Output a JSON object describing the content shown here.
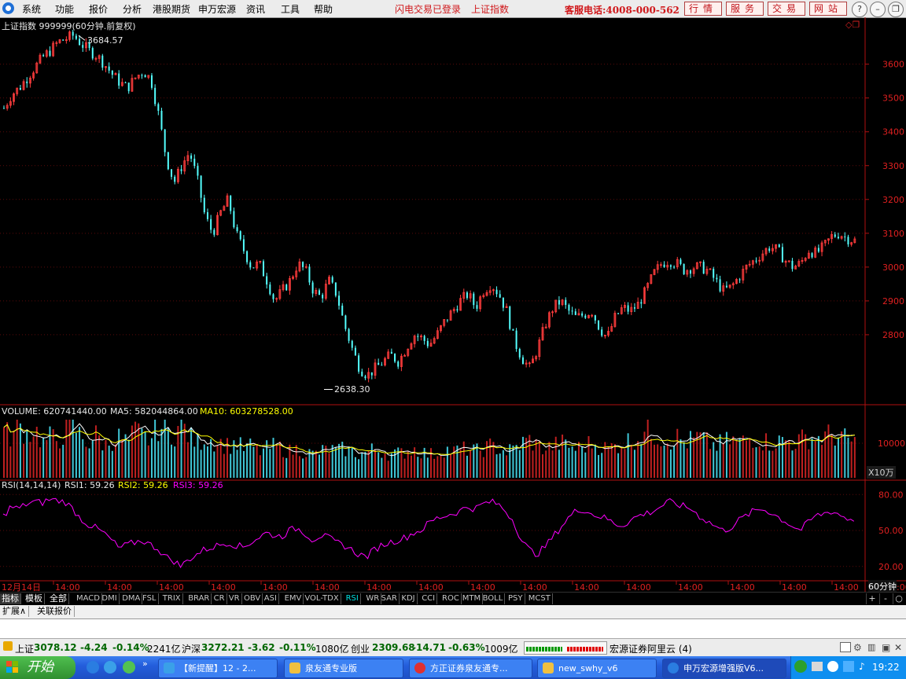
{
  "menubar": {
    "items": [
      "系统",
      "功能",
      "报价",
      "分析",
      "港股期货",
      "申万宏源",
      "资讯",
      "工具",
      "帮助"
    ],
    "notice1": "闪电交易已登录",
    "notice2": "上证指数",
    "hotline": "客服电话:4008-000-562",
    "buttons": [
      "行情",
      "服务",
      "交易",
      "网站"
    ],
    "window_controls": [
      "?",
      "–",
      "❐",
      "✕"
    ]
  },
  "chart": {
    "title": "上证指数 999999(60分钟.前复权)",
    "high_label": "3684.57",
    "low_label": "2638.30",
    "price_ticks": [
      "3600",
      "3500",
      "3400",
      "3300",
      "3200",
      "3100",
      "3000",
      "2900",
      "2800"
    ],
    "volume": {
      "label": "VOLUME: 620741440.00",
      "ma5": "MA5: 582044864.00",
      "ma10": "MA10: 603278528.00",
      "tick": "10000",
      "unit": "X10万"
    },
    "rsi": {
      "label": "RSI(14,14,14)",
      "rsi1": "RSI1: 59.26",
      "rsi2": "RSI2: 59.26",
      "rsi3": "RSI3: 59.26",
      "ticks": [
        "80.00",
        "50.00",
        "20.00"
      ]
    },
    "time_labels": [
      "12月14日",
      "14:00",
      "14:00",
      "14:00",
      "14:00",
      "14:00",
      "14:00",
      "14:00",
      "14:00",
      "14:00",
      "14:00",
      "14:00",
      "14:00",
      "14:00",
      "14:00",
      "14:00",
      "14:00",
      "14:00"
    ],
    "period": "60分钟",
    "colors": {
      "up": "#ff3c3c",
      "down": "#54ffff",
      "ma5": "#ffffff",
      "ma10": "#ffff00",
      "rsi": "#ff00ff",
      "axis": "#b01010"
    }
  },
  "chart_data": {
    "type": "candlestick",
    "title": "上证指数 999999(60分钟.前复权)",
    "y_range": [
      2600,
      3720
    ],
    "y_ticks": [
      3600,
      3500,
      3400,
      3300,
      3200,
      3100,
      3000,
      2900,
      2800
    ],
    "high": 3684.57,
    "low": 2638.3,
    "close_path": [
      3470,
      3510,
      3530,
      3560,
      3590,
      3620,
      3640,
      3665,
      3675,
      3685,
      3660,
      3640,
      3625,
      3600,
      3570,
      3545,
      3530,
      3560,
      3580,
      3555,
      3450,
      3320,
      3250,
      3300,
      3340,
      3260,
      3150,
      3100,
      3160,
      3200,
      3100,
      3050,
      3000,
      3010,
      2960,
      2900,
      2930,
      2960,
      3010,
      2990,
      2930,
      2910,
      2960,
      2920,
      2830,
      2760,
      2700,
      2680,
      2700,
      2720,
      2740,
      2720,
      2760,
      2800,
      2790,
      2770,
      2800,
      2840,
      2870,
      2900,
      2920,
      2880,
      2930,
      2950,
      2920,
      2870,
      2780,
      2730,
      2700,
      2760,
      2830,
      2880,
      2900,
      2870,
      2850,
      2860,
      2870,
      2820,
      2790,
      2850,
      2880,
      2870,
      2890,
      2930,
      2980,
      3010,
      3020,
      3010,
      2990,
      3000,
      3000,
      2990,
      2960,
      2930,
      2940,
      2970,
      3000,
      3020,
      3040,
      3060,
      3050,
      3020,
      3000,
      3010,
      3050,
      3040,
      3060,
      3090,
      3100,
      3085,
      3078
    ],
    "volume_relative": [
      0.8,
      0.7,
      0.9,
      0.75,
      0.85,
      0.6,
      0.7,
      0.65,
      0.8,
      0.9,
      0.7,
      0.6,
      0.75,
      0.55,
      0.65,
      0.7,
      0.6,
      0.8,
      0.7,
      0.65,
      0.9,
      0.8,
      0.75,
      0.95,
      0.7,
      0.6,
      0.7,
      0.65,
      0.6,
      0.55,
      0.6,
      0.5,
      0.55,
      0.45,
      0.5,
      0.55,
      0.5,
      0.45,
      0.5,
      0.45,
      0.4,
      0.45,
      0.5,
      0.45,
      0.5,
      0.45,
      0.4,
      0.45,
      0.5,
      0.45,
      0.4,
      0.42,
      0.45,
      0.5,
      0.45,
      0.4,
      0.42,
      0.5,
      0.45,
      0.48,
      0.5,
      0.45,
      0.5,
      0.55,
      0.5,
      0.45,
      0.5,
      0.6,
      0.65,
      0.55,
      0.5,
      0.55,
      0.6,
      0.55,
      0.5,
      0.55,
      0.6,
      0.55,
      0.5,
      0.55,
      0.6,
      0.65,
      0.7,
      0.8,
      0.75,
      0.7,
      0.65,
      0.7,
      0.6,
      0.65,
      0.7,
      0.6,
      0.55,
      0.6,
      0.65,
      0.6,
      0.65,
      0.7,
      0.65,
      0.6,
      0.62,
      0.65,
      0.6,
      0.65,
      0.7,
      0.68,
      0.7,
      0.75,
      0.7,
      0.65,
      0.62
    ],
    "rsi_path": [
      62,
      70,
      68,
      72,
      74,
      73,
      76,
      75,
      74,
      68,
      60,
      55,
      52,
      48,
      42,
      35,
      38,
      40,
      42,
      38,
      35,
      28,
      25,
      20,
      26,
      30,
      34,
      36,
      38,
      40,
      38,
      36,
      40,
      44,
      48,
      46,
      45,
      50,
      52,
      48,
      42,
      46,
      44,
      40,
      38,
      34,
      30,
      28,
      34,
      38,
      40,
      42,
      44,
      48,
      50,
      56,
      60,
      62,
      64,
      66,
      70,
      68,
      72,
      74,
      72,
      66,
      58,
      42,
      34,
      30,
      36,
      44,
      52,
      60,
      66,
      68,
      64,
      62,
      60,
      56,
      54,
      58,
      62,
      64,
      66,
      70,
      74,
      72,
      70,
      68,
      62,
      58,
      54,
      50,
      52,
      58,
      62,
      66,
      68,
      66,
      62,
      58,
      54,
      50,
      56,
      62,
      64,
      66,
      64,
      60,
      59
    ]
  },
  "indicator_bar": {
    "left_tabs": [
      "指标",
      "模板",
      "全部"
    ],
    "indicators": [
      "MACD",
      "DMI",
      "DMA",
      "FSL",
      "TRIX",
      "BRAR",
      "CR",
      "VR",
      "OBV",
      "ASI",
      "EMV",
      "VOL-TDX",
      "RSI",
      "WR",
      "SAR",
      "KDJ",
      "CCI",
      "ROC",
      "MTM",
      "BOLL",
      "PSY",
      "MCST"
    ],
    "active": "RSI",
    "controls": [
      "+",
      "-",
      "○"
    ]
  },
  "ext_bar": {
    "tabs": [
      "扩展∧",
      "关联报价"
    ]
  },
  "status": {
    "sh_label": "上证",
    "sh_value": "3078.12",
    "sh_change": "-4.24",
    "sh_pct": "-0.14%",
    "sh_amount": "2241亿",
    "hs_label": "沪深",
    "hs_value": "3272.21",
    "hs_change": "-3.62",
    "hs_pct": "-0.11%",
    "hs_amount": "1080亿",
    "cy_label": "创业",
    "cy_value": "2309.68",
    "cy_change": "-14.71",
    "cy_pct": "-0.63%",
    "cy_amount": "1009亿",
    "server": "宏源证券阿里云 (4)"
  },
  "taskbar": {
    "start": "开始",
    "tasks": [
      "【新提醒】12 - 2...",
      "泉友通专业版",
      "方正证券泉友通专...",
      "new_swhy_v6",
      "申万宏源增强版V6..."
    ],
    "clock": "19:22"
  }
}
